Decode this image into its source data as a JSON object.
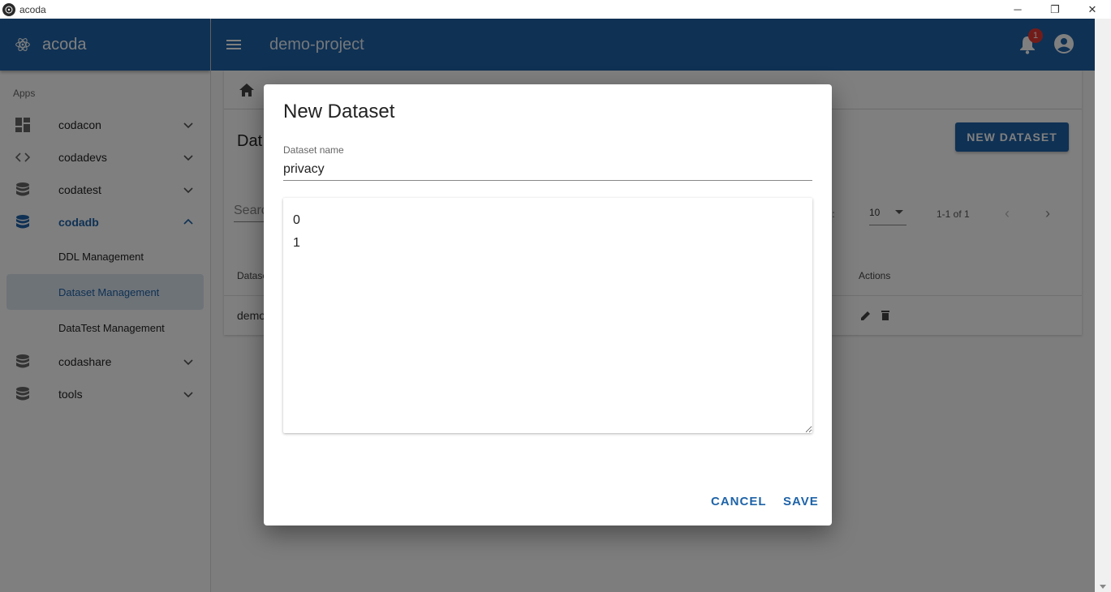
{
  "window": {
    "title": "acoda",
    "minimize": "─",
    "restore": "❐",
    "close": "✕"
  },
  "sidebar": {
    "brand": "acoda",
    "apps_label": "Apps",
    "items": [
      {
        "label": "codacon"
      },
      {
        "label": "codadevs"
      },
      {
        "label": "codatest"
      },
      {
        "label": "codadb"
      },
      {
        "label": "codashare"
      },
      {
        "label": "tools"
      }
    ],
    "sub_items": [
      {
        "label": "DDL Management"
      },
      {
        "label": "Dataset Management"
      },
      {
        "label": "DataTest Management"
      }
    ]
  },
  "header": {
    "project_title": "demo-project",
    "notification_count": "1"
  },
  "page": {
    "section_title": "Dat",
    "new_button": "NEW DATASET",
    "search_placeholder": "Searc",
    "rows_per_page_label": "ge:",
    "rows_per_page": "10",
    "range": "1-1 of 1",
    "columns": {
      "dataset": "Datase",
      "actions": "Actions"
    },
    "rows": [
      {
        "dataset": "demo"
      }
    ]
  },
  "dialog": {
    "title": "New Dataset",
    "field_label": "Dataset name",
    "field_value": "privacy",
    "textarea_value": "0\n1",
    "cancel_label": "CANCEL",
    "save_label": "SAVE"
  },
  "colors": {
    "primary": "#1e63a8",
    "badge": "#e53935",
    "selected_bg": "#dde6f0"
  }
}
